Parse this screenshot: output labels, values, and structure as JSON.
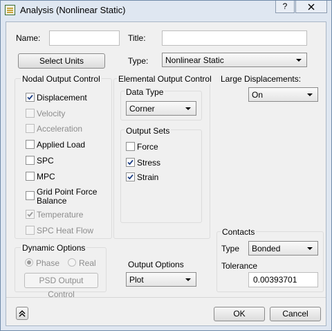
{
  "window": {
    "title": "Analysis (Nonlinear Static)",
    "help_label": "?",
    "close_label": "X"
  },
  "name": {
    "label": "Name:",
    "value": ""
  },
  "title_field": {
    "label": "Title:",
    "value": ""
  },
  "select_units_label": "Select Units",
  "type": {
    "label": "Type:",
    "value": "Nonlinear Static"
  },
  "nodal": {
    "title": "Nodal Output Control",
    "items": [
      {
        "label": "Displacement",
        "checked": true,
        "enabled": true
      },
      {
        "label": "Velocity",
        "checked": false,
        "enabled": false
      },
      {
        "label": "Acceleration",
        "checked": false,
        "enabled": false
      },
      {
        "label": "Applied Load",
        "checked": false,
        "enabled": true
      },
      {
        "label": "SPC",
        "checked": false,
        "enabled": true
      },
      {
        "label": "MPC",
        "checked": false,
        "enabled": true
      },
      {
        "label": "Grid Point Force",
        "label2": "Balance",
        "checked": false,
        "enabled": true
      },
      {
        "label": "Temperature",
        "checked": true,
        "enabled": false
      },
      {
        "label": "SPC Heat Flow",
        "checked": false,
        "enabled": false
      }
    ]
  },
  "elemental": {
    "title": "Elemental Output Control",
    "data_type": {
      "title": "Data Type",
      "value": "Corner"
    },
    "output_sets": {
      "title": "Output Sets",
      "items": [
        {
          "label": "Force",
          "checked": false
        },
        {
          "label": "Stress",
          "checked": true
        },
        {
          "label": "Strain",
          "checked": true
        }
      ]
    }
  },
  "large_displacements": {
    "label": "Large Displacements:",
    "value": "On"
  },
  "dynamic": {
    "title": "Dynamic Options",
    "phase_label": "Phase",
    "real_label": "Real",
    "selected": "Phase",
    "psd_button": "PSD Output Control"
  },
  "output_options": {
    "label": "Output Options",
    "value": "Plot"
  },
  "contacts": {
    "title": "Contacts",
    "type_label": "Type",
    "type_value": "Bonded",
    "tolerance_label": "Tolerance",
    "tolerance_value": "0.00393701"
  },
  "footer": {
    "expand_icon_label": "expand",
    "ok_label": "OK",
    "cancel_label": "Cancel"
  }
}
